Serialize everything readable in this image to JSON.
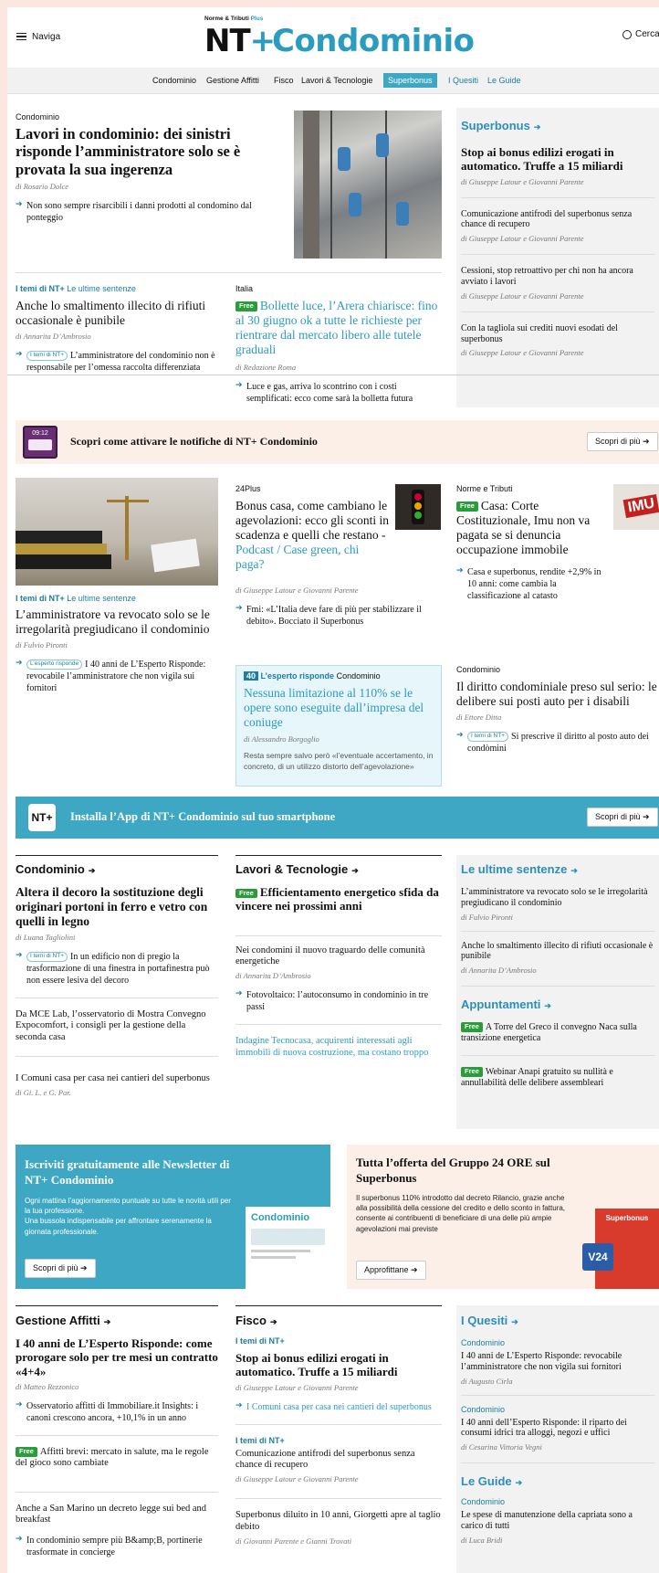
{
  "header": {
    "menu_label": "Naviga",
    "logo_top": "Norme & Tributi",
    "logo_top_plus": "Plus",
    "logo_nt": "NT",
    "logo_plus": "+",
    "logo_title": "Condominio",
    "search_label": "Cerca"
  },
  "nav": {
    "items": [
      "Condominio",
      "Gestione Affitti",
      "Fisco",
      "Lavori & Tecnologie",
      "Superbonus",
      "I Quesiti",
      "Le Guide"
    ]
  },
  "lead": {
    "kicker": "Condominio",
    "title": "Lavori in condominio: dei sinistri risponde l’amministratore solo se è provata la sua ingerenza",
    "author": "di Rosario Dolce",
    "bullet": "Non sono sempre risarcibili i danni prodotti al condomino dal ponteggio"
  },
  "story2": {
    "kicker_a": "I temi di NT+",
    "kicker_b": "Le ultime sentenze",
    "title": "Anche lo smaltimento illecito di rifiuti occasionale è punibile",
    "author": "di Annarita D’Ambrosio",
    "pill": "I temi di NT+",
    "bullet": "L’amministratore del condominio non è responsabile per l’omessa raccolta differenziata"
  },
  "story3": {
    "kicker": "Italia",
    "free": "Free",
    "title": "Bollette luce, l’Arera chiarisce: fino al 30 giugno ok a tutte le richieste per rientrare dal mercato libero alle tutele graduali",
    "author": "di Redazione Roma",
    "bullet": "Luce e gas, arriva lo scontrino con i costi semplificati: ecco come sarà la bolletta futura"
  },
  "superbonus_box": {
    "title": "Superbonus",
    "items": [
      {
        "title": "Stop ai bonus edilizi erogati in automatico. Truffe a 15 miliardi",
        "author": "di Giuseppe Latour e Giovanni Parente"
      },
      {
        "title": "Comunicazione antifrodi del superbonus senza chance di recupero",
        "author": "di Giuseppe Latour e Giovanni Parente"
      },
      {
        "title": "Cessioni, stop retroattivo per chi non ha ancora avviato i lavori",
        "author": "di Giuseppe Latour e Giovanni Parente"
      },
      {
        "title": "Con la tagliola sui crediti nuovi esodati del superbonus",
        "author": "di Giuseppe Latour e Giovanni Parente"
      }
    ]
  },
  "notify": {
    "phone_time": "09:12",
    "text": "Scopri come attivare le notifiche di NT+ Condominio",
    "button": "Scopri di più"
  },
  "row2": {
    "a": {
      "kicker_a": "I temi di NT+",
      "kicker_b": "Le ultime sentenze",
      "title": "L’amministratore va revocato solo se le irregolarità pregiudicano il condominio",
      "author": "di Fulvio Pironti",
      "pill": "L’esperto risponde",
      "bullet": "I 40 anni de L’Esperto Risponde: revocabile l’amministratore che non vigila sui fornitori"
    },
    "b": {
      "kicker": "24Plus",
      "title": "Bonus casa, come cambiano le agevolazioni: ecco gli sconti in scadenza e quelli che restano -",
      "title_blue": "Podcast / Case green, chi paga?",
      "author": "di Giuseppe Latour e Giovanni Parente",
      "bullet": "Fmi: «L’Italia deve fare di più per stabilizzare il debito». Bocciato il Superbonus"
    },
    "c": {
      "kicker": "Norme e Tributi",
      "free": "Free",
      "title": "Casa: Corte Costituzionale, Imu non va pagata se si denuncia occupazione immobile",
      "bullet": "Casa e superbonus, rendite +2,9% in 10 anni: come cambia la classificazione al catasto",
      "img_text": "IMU"
    },
    "d": {
      "badge": "40",
      "kicker_a": "L’esperto risponde",
      "kicker_b": "Condominio",
      "title": "Nessuna limitazione al 110% se le opere sono eseguite dall’impresa del coniuge",
      "author": "di Alessandro Borgoglio",
      "desc": "Resta sempre salvo però «l’eventuale accertamento, in concreto, di un utilizzo distorto dell’agevolazione»"
    },
    "e": {
      "kicker": "Condominio",
      "title": "Il diritto condominiale preso sul serio: le delibere sui posti auto per i disabili",
      "author": "di Ettore Ditta",
      "pill": "I temi di NT+",
      "bullet": "Si prescrive il diritto al posto auto dei condòmini"
    }
  },
  "app_banner": {
    "icon": "NT+",
    "text": "Installa l’App di NT+ Condominio sul tuo smartphone",
    "button": "Scopri di più"
  },
  "sec_condominio": {
    "title": "Condominio",
    "lead_title": "Altera il decoro la sostituzione degli originari portoni in ferro e vetro con quelli in legno",
    "lead_author": "di Luana Tagliolini",
    "pill": "I temi di NT+",
    "bullet": "In un edificio non di pregio la trasformazione di una finestra in portafinestra può non essere lesiva del decoro",
    "item2": "Da MCE Lab, l’osservatorio di Mostra Convegno Expocomfort, i consigli per la gestione della seconda casa",
    "item3": "I Comuni casa per casa nei cantieri del superbonus",
    "item3_author": "di Gi. L. e G. Par."
  },
  "sec_lavori": {
    "title": "Lavori & Tecnologie",
    "free": "Free",
    "lead_title": "Efficientamento energetico sfida da vincere nei prossimi anni",
    "item2": "Nei condomini il nuovo traguardo delle comunità energetiche",
    "item2_author": "di Annarita D’Ambrosio",
    "bullet": "Fotovoltaico: l’autoconsumo in condominio in tre passi",
    "item3": "Indagine Tecnocasa, acquirenti interessati agli immobili di nuova costruzione, ma costano troppo"
  },
  "sec_sentenze": {
    "title": "Le ultime sentenze",
    "items": [
      {
        "title": "L’amministratore va revocato solo se le irregolarità pregiudicano il condominio",
        "author": "di Fulvio Pironti"
      },
      {
        "title": "Anche lo smaltimento illecito di rifiuti occasionale è punibile",
        "author": "di Annarita D’Ambrosio"
      }
    ]
  },
  "sec_appuntamenti": {
    "title": "Appuntamenti",
    "items": [
      {
        "free": "Free",
        "title": "A Torre del Greco il convegno Naca sulla transizione energetica"
      },
      {
        "free": "Free",
        "title": "Webinar Anapi gratuito su nullità e annullabilità delle delibere assembleari"
      }
    ]
  },
  "newsletter": {
    "title": "Iscriviti gratuitamente alle Newsletter di NT+ Condominio",
    "desc1": "Ogni mattina l’aggiornamento puntuale su tutte le novità utili per la tua professione.",
    "desc2": "Una bussola indispensabile per affrontare serenamente la giornata professionale.",
    "button": "Scopri di più",
    "mock_title": "Condominio"
  },
  "offer": {
    "title": "Tutta l’offerta del Gruppo 24 ORE sul Superbonus",
    "desc": "Il superbonus 110% introdotto dal decreto Rilancio, grazie anche alla possibilità della cessione del credito e dello sconto in fattura, consente ai contribuenti di beneficiare di una delle più ampie agevolazioni mai previste",
    "button": "Approfittane",
    "book_title": "Superbonus",
    "v24": "V24"
  },
  "sec_affitti": {
    "title": "Gestione Affitti",
    "lead_title": "I 40 anni de L’Esperto Risponde: come prorogare solo per tre mesi un contratto «4+4»",
    "lead_author": "di Matteo Rezzonico",
    "bullet": "Osservatorio affitti di Immobiliare.it Insights: i canoni crescono ancora, +10,1% in un anno",
    "free": "Free",
    "item2": "Affitti brevi: mercato in salute, ma le regole del gioco sono cambiate",
    "item3": "Anche a San Marino un decreto legge sui bed and breakfast",
    "bullet2": "In condominio sempre più B&amp;B, portinerie trasformate in concierge"
  },
  "sec_fisco": {
    "title": "Fisco",
    "kicker": "I temi di NT+",
    "lead_title": "Stop ai bonus edilizi erogati in automatico. Truffe a 15 miliardi",
    "lead_author": "di Giuseppe Latour e Giovanni Parente",
    "bullet": "I Comuni casa per casa nei cantieri del superbonus",
    "kicker2": "I temi di NT+",
    "item2": "Comunicazione antifrodi del superbonus senza chance di recupero",
    "item2_author": "di Giuseppe Latour e Giovanni Parente",
    "item3": "Superbonus diluito in 10 anni, Giorgetti apre al taglio debito",
    "item3_author": "di Giovanni Parente e Gianni Trovati"
  },
  "sec_quesiti": {
    "title": "I Quesiti",
    "items": [
      {
        "kicker": "Condominio",
        "title": "I 40 anni de L’Esperto Risponde: revocabile l’amministratore che non vigila sui fornitori",
        "author": "di Augusto Cirla"
      },
      {
        "kicker": "Condominio",
        "title": "I 40 anni dell’Esperto Risponde: il riparto dei consumi idrici tra alloggi, negozi e uffici",
        "author": "di Cesarina Vittoria Vegni"
      }
    ]
  },
  "sec_guide": {
    "title": "Le Guide",
    "kicker": "Condominio",
    "title_item": "Le spese di manutenzione della capriata sono a carico di tutti",
    "author": "di Luca Bridi"
  },
  "colors": {
    "brand": "#2c9bc0",
    "free": "#2a9d3a",
    "banner": "#3ea8c4"
  }
}
